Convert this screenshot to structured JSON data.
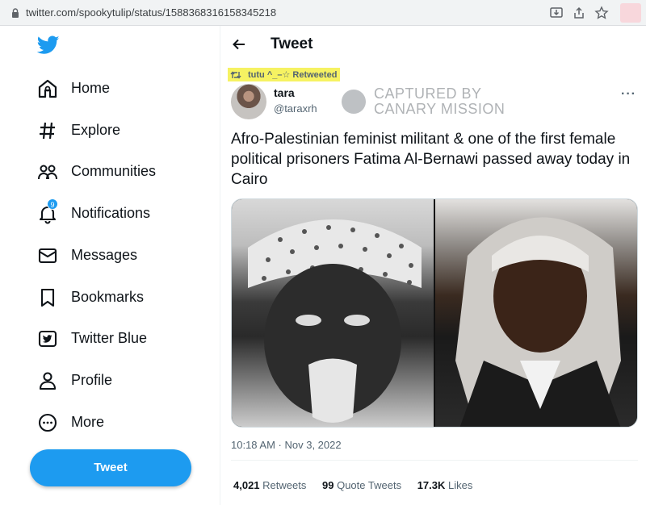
{
  "browser": {
    "url": "twitter.com/spookytulip/status/1588368316158345218"
  },
  "sidebar": {
    "items": [
      {
        "label": "Home",
        "icon": "home-icon"
      },
      {
        "label": "Explore",
        "icon": "hashtag-icon"
      },
      {
        "label": "Communities",
        "icon": "communities-icon"
      },
      {
        "label": "Notifications",
        "icon": "bell-icon",
        "badge": "9"
      },
      {
        "label": "Messages",
        "icon": "envelope-icon"
      },
      {
        "label": "Bookmarks",
        "icon": "bookmark-icon"
      },
      {
        "label": "Twitter Blue",
        "icon": "twitter-blue-icon"
      },
      {
        "label": "Profile",
        "icon": "person-icon"
      },
      {
        "label": "More",
        "icon": "more-circle-icon"
      }
    ],
    "tweet_button": "Tweet"
  },
  "header": {
    "title": "Tweet"
  },
  "tweet": {
    "retweet_line": "tutu ^_–☆ Retweeted",
    "display_name": "tara",
    "handle": "@taraxrh",
    "text": "Afro-Palestinian feminist militant & one of the first female political prisoners Fatima Al-Bernawi passed away today in Cairo",
    "timestamp": "10:18 AM · Nov 3, 2022",
    "stats": {
      "retweets_count": "4,021",
      "retweets_label": "Retweets",
      "quotes_count": "99",
      "quotes_label": "Quote Tweets",
      "likes_count": "17.3K",
      "likes_label": "Likes"
    }
  },
  "watermark": {
    "line1": "CAPTURED BY",
    "line2": "CANARY MISSION"
  },
  "colors": {
    "accent": "#1d9bf0",
    "highlight": "#f6f262"
  }
}
